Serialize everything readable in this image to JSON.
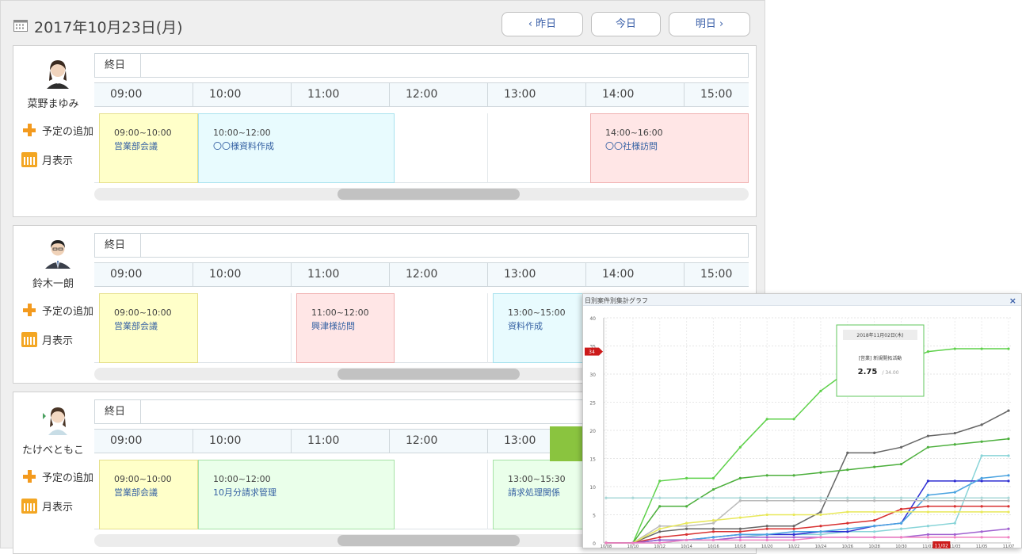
{
  "header": {
    "date": "2017年10月23日(月)",
    "prev_label": "‹ 昨日",
    "today_label": "今日",
    "next_label": "明日 ›"
  },
  "common": {
    "allday_label": "終日",
    "add_label": "予定の追加",
    "month_label": "月表示",
    "times": [
      "09:00",
      "10:00",
      "11:00",
      "12:00",
      "13:00",
      "14:00",
      "15:00"
    ]
  },
  "users": [
    {
      "name": "菜野まゆみ",
      "events": [
        {
          "time": "09:00~10:00",
          "title": "営業部会議"
        },
        {
          "time": "10:00~12:00",
          "title": "〇〇様資料作成"
        },
        {
          "time": "14:00~16:00",
          "title": "〇〇社様訪問"
        }
      ]
    },
    {
      "name": "鈴木一朗",
      "events": [
        {
          "time": "09:00~10:00",
          "title": "営業部会議"
        },
        {
          "time": "11:00~12:00",
          "title": "興津様訪問"
        },
        {
          "time": "13:00~15:00",
          "title": "資料作成"
        }
      ]
    },
    {
      "name": "たけべともこ",
      "events": [
        {
          "time": "09:00~10:00",
          "title": "営業部会議"
        },
        {
          "time": "10:00~12:00",
          "title": "10月分請求管理"
        },
        {
          "time": "13:00~15:30",
          "title": "請求処理関係"
        }
      ]
    }
  ],
  "chart_window": {
    "title": "日別案件別集計グラフ",
    "close": "×",
    "tooltip_date": "2018年11月02日(木)",
    "tooltip_series": "[営業] 新規開拓活動",
    "tooltip_value": "2.75",
    "tooltip_total": "/ 34.00",
    "flag_y": "34",
    "flag_x": "11/02"
  },
  "chart_data": {
    "type": "line",
    "title": "日別案件別集計グラフ",
    "xlabel": "",
    "ylabel": "",
    "ylim": [
      0,
      40
    ],
    "y_ticks": [
      "0",
      "5",
      "10",
      "15",
      "20",
      "25",
      "30",
      "35",
      "40"
    ],
    "x": [
      "10/08",
      "10/10",
      "10/12",
      "10/14",
      "10/16",
      "10/18",
      "10/20",
      "10/22",
      "10/24",
      "10/26",
      "10/28",
      "10/30",
      "11/01",
      "11/03",
      "11/05",
      "11/07"
    ],
    "series": [
      {
        "color": "#5ed14a",
        "values": [
          0,
          0,
          11,
          11.5,
          11.5,
          17,
          22,
          22,
          27,
          30.5,
          31.5,
          32,
          34,
          34.5,
          34.5,
          34.5
        ]
      },
      {
        "color": "#666666",
        "values": [
          0,
          0,
          2,
          2.5,
          2.5,
          2.5,
          3,
          3,
          5.5,
          16,
          16,
          17,
          19,
          19.5,
          21,
          23.5
        ]
      },
      {
        "color": "#4caf3c",
        "values": [
          0,
          0,
          6.5,
          6.5,
          9.5,
          11.5,
          12,
          12,
          12.5,
          13,
          13.5,
          14,
          17,
          17.5,
          18,
          18.5
        ]
      },
      {
        "color": "#88d4d8",
        "values": [
          0,
          0,
          0,
          0.5,
          0.5,
          1,
          1.5,
          1.5,
          1.5,
          2,
          2,
          2.5,
          3,
          3.5,
          15.5,
          15.5
        ]
      },
      {
        "color": "#2d2dd2",
        "values": [
          0,
          0,
          0.5,
          0.5,
          1,
          1.5,
          1.5,
          1.5,
          2,
          2,
          3,
          3.5,
          11,
          11,
          11,
          11
        ]
      },
      {
        "color": "#4aa3e0",
        "values": [
          0,
          0,
          0.5,
          0.5,
          1,
          1.5,
          1.5,
          2,
          2,
          2.5,
          3,
          3.5,
          8.5,
          9,
          11.5,
          12
        ]
      },
      {
        "color": "#a8d8d8",
        "values": [
          8,
          8,
          8,
          8,
          8,
          8,
          8,
          8,
          8,
          8,
          8,
          8,
          8,
          8,
          8,
          8
        ]
      },
      {
        "color": "#d83030",
        "values": [
          0,
          0,
          1,
          1.5,
          2,
          2,
          2.5,
          2.5,
          3,
          3.5,
          4,
          6,
          6.5,
          6.5,
          6.5,
          6.5
        ]
      },
      {
        "color": "#bbbbbb",
        "values": [
          0,
          0,
          3,
          3,
          3.5,
          7.5,
          7.5,
          7.5,
          7.5,
          7.5,
          7.5,
          7.5,
          7.5,
          7.5,
          7.5,
          7.5
        ]
      },
      {
        "color": "#e8e85a",
        "values": [
          0,
          0,
          2.5,
          3.5,
          4,
          4.5,
          5,
          5,
          5,
          5.5,
          5.5,
          5.5,
          5.5,
          5.5,
          5.5,
          5.5
        ]
      },
      {
        "color": "#a060d0",
        "values": [
          0,
          0,
          0.5,
          0.5,
          0.5,
          1,
          1,
          1,
          1,
          1,
          1,
          1,
          1.5,
          1.5,
          2,
          2.5
        ]
      },
      {
        "color": "#f080c0",
        "values": [
          0,
          0,
          0,
          0.5,
          0.5,
          0.5,
          0.5,
          0.5,
          1,
          1,
          1,
          1,
          1,
          1,
          1,
          1
        ]
      }
    ]
  }
}
